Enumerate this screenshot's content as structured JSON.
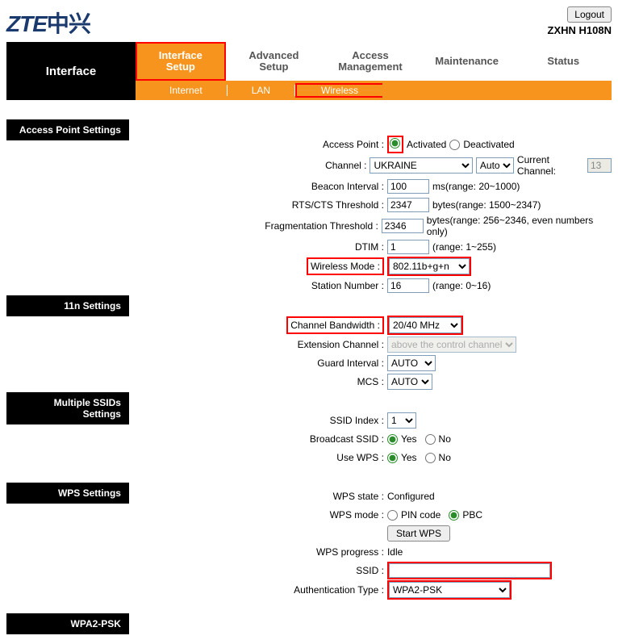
{
  "header": {
    "brand_en": "ZTE",
    "brand_cn": "中兴",
    "logout": "Logout",
    "model": "ZXHN H108N"
  },
  "nav": {
    "left_title": "Interface",
    "tabs": [
      "Interface Setup",
      "Advanced Setup",
      "Access Management",
      "Maintenance",
      "Status"
    ],
    "subtabs": [
      "Internet",
      "LAN",
      "Wireless"
    ]
  },
  "sections": {
    "ap": "Access Point Settings",
    "n11": "11n Settings",
    "mssid": "Multiple SSIDs Settings",
    "wps": "WPS Settings",
    "wpa2": "WPA2-PSK"
  },
  "ap": {
    "access_point_label": "Access Point :",
    "activated": "Activated",
    "deactivated": "Deactivated",
    "channel_label": "Channel :",
    "channel_country": "UKRAINE",
    "channel_auto": "Auto",
    "current_channel_label": "Current Channel:",
    "current_channel": "13",
    "beacon_label": "Beacon Interval :",
    "beacon_value": "100",
    "beacon_range": "ms(range: 20~1000)",
    "rts_label": "RTS/CTS Threshold :",
    "rts_value": "2347",
    "rts_range": "bytes(range: 1500~2347)",
    "frag_label": "Fragmentation Threshold :",
    "frag_value": "2346",
    "frag_range": "bytes(range: 256~2346, even numbers only)",
    "dtim_label": "DTIM :",
    "dtim_value": "1",
    "dtim_range": "(range: 1~255)",
    "wmode_label": "Wireless Mode :",
    "wmode_value": "802.11b+g+n",
    "station_label": "Station Number :",
    "station_value": "16",
    "station_range": "(range: 0~16)"
  },
  "n11": {
    "bw_label": "Channel Bandwidth :",
    "bw_value": "20/40 MHz",
    "ext_label": "Extension Channel :",
    "ext_value": "above the control channel",
    "gi_label": "Guard Interval :",
    "gi_value": "AUTO",
    "mcs_label": "MCS :",
    "mcs_value": "AUTO"
  },
  "mssid": {
    "index_label": "SSID Index :",
    "index_value": "1",
    "broadcast_label": "Broadcast SSID :",
    "wps_label": "Use WPS :",
    "yes": "Yes",
    "no": "No"
  },
  "wps": {
    "state_label": "WPS state :",
    "state_value": "Configured",
    "mode_label": "WPS mode :",
    "pin": "PIN code",
    "pbc": "PBC",
    "start_btn": "Start WPS",
    "progress_label": "WPS progress :",
    "progress_value": "Idle",
    "ssid_label": "SSID :",
    "ssid_value": "",
    "auth_label": "Authentication Type :",
    "auth_value": "WPA2-PSK"
  }
}
